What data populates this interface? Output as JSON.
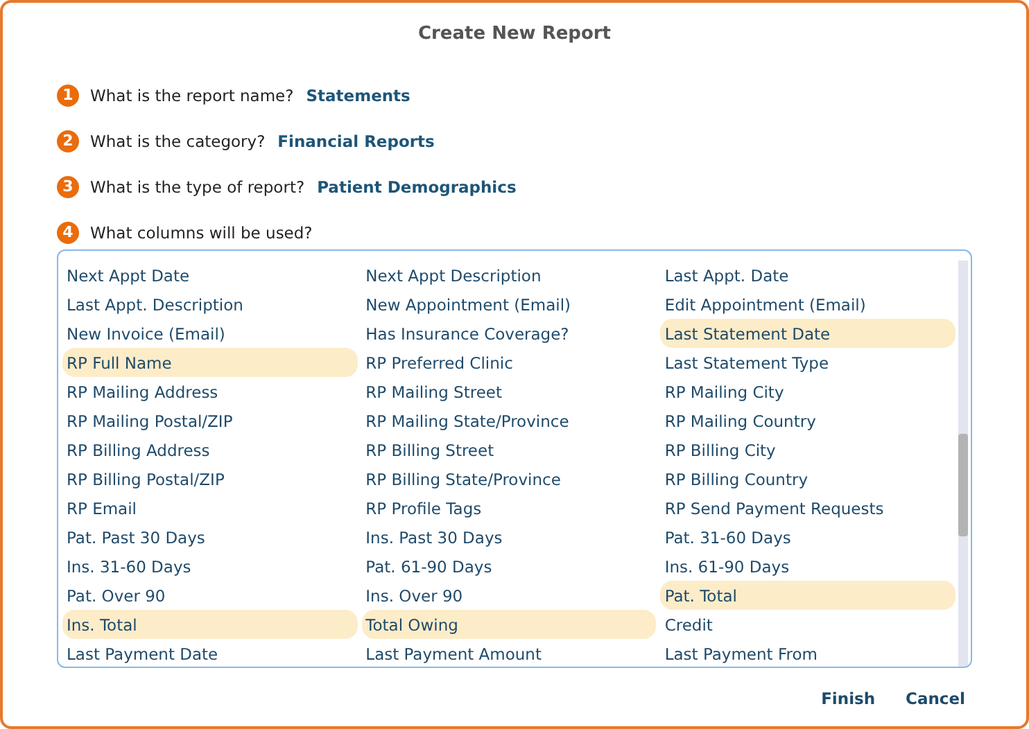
{
  "dialog": {
    "title": "Create New Report"
  },
  "steps": [
    {
      "number": "1",
      "question": "What is the report name?",
      "answer": "Statements"
    },
    {
      "number": "2",
      "question": "What is the category?",
      "answer": "Financial Reports"
    },
    {
      "number": "3",
      "question": "What is the type of report?",
      "answer": "Patient Demographics"
    },
    {
      "number": "4",
      "question": "What columns will be used?"
    }
  ],
  "columns": [
    {
      "label": "Next Appt Date",
      "selected": false
    },
    {
      "label": "Next Appt Description",
      "selected": false
    },
    {
      "label": "Last Appt. Date",
      "selected": false
    },
    {
      "label": "Last Appt. Description",
      "selected": false
    },
    {
      "label": "New Appointment (Email)",
      "selected": false
    },
    {
      "label": "Edit Appointment (Email)",
      "selected": false
    },
    {
      "label": "New Invoice (Email)",
      "selected": false
    },
    {
      "label": "Has Insurance Coverage?",
      "selected": false
    },
    {
      "label": "Last Statement Date",
      "selected": true
    },
    {
      "label": "RP Full Name",
      "selected": true
    },
    {
      "label": "RP Preferred Clinic",
      "selected": false
    },
    {
      "label": "Last Statement Type",
      "selected": false
    },
    {
      "label": "RP Mailing Address",
      "selected": false
    },
    {
      "label": "RP Mailing Street",
      "selected": false
    },
    {
      "label": "RP Mailing City",
      "selected": false
    },
    {
      "label": "RP Mailing Postal/ZIP",
      "selected": false
    },
    {
      "label": "RP Mailing State/Province",
      "selected": false
    },
    {
      "label": "RP Mailing Country",
      "selected": false
    },
    {
      "label": "RP Billing Address",
      "selected": false
    },
    {
      "label": "RP Billing Street",
      "selected": false
    },
    {
      "label": "RP Billing City",
      "selected": false
    },
    {
      "label": "RP Billing Postal/ZIP",
      "selected": false
    },
    {
      "label": "RP Billing State/Province",
      "selected": false
    },
    {
      "label": "RP Billing Country",
      "selected": false
    },
    {
      "label": "RP Email",
      "selected": false
    },
    {
      "label": "RP Profile Tags",
      "selected": false
    },
    {
      "label": "RP Send Payment Requests",
      "selected": false
    },
    {
      "label": "Pat. Past 30 Days",
      "selected": false
    },
    {
      "label": "Ins. Past 30 Days",
      "selected": false
    },
    {
      "label": "Pat. 31-60 Days",
      "selected": false
    },
    {
      "label": "Ins. 31-60 Days",
      "selected": false
    },
    {
      "label": "Pat. 61-90 Days",
      "selected": false
    },
    {
      "label": "Ins. 61-90 Days",
      "selected": false
    },
    {
      "label": "Pat. Over 90",
      "selected": false
    },
    {
      "label": "Ins. Over 90",
      "selected": false
    },
    {
      "label": "Pat. Total",
      "selected": true
    },
    {
      "label": "Ins. Total",
      "selected": true
    },
    {
      "label": "Total Owing",
      "selected": true
    },
    {
      "label": "Credit",
      "selected": false
    },
    {
      "label": "Last Payment Date",
      "selected": false
    },
    {
      "label": "Last Payment Amount",
      "selected": false
    },
    {
      "label": "Last Payment From",
      "selected": false
    }
  ],
  "buttons": [
    "Finish",
    "Cancel"
  ]
}
